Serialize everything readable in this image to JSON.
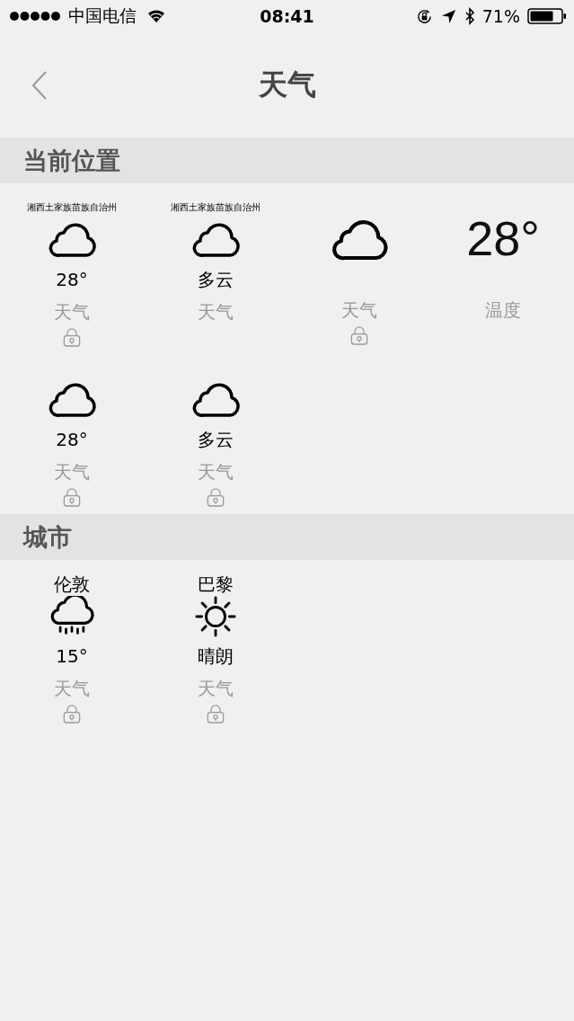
{
  "status_bar": {
    "carrier": "中国电信",
    "time": "08:41",
    "battery": "71%"
  },
  "nav": {
    "title": "天气"
  },
  "sections": [
    {
      "title": "当前位置",
      "widgets": [
        {
          "place": "湘西土家族苗族自治州",
          "kind": "cloud",
          "value": "28°",
          "caption": "天气",
          "locked": true
        },
        {
          "place": "湘西土家族苗族自治州",
          "kind": "cloud",
          "value": "多云",
          "caption": "天气",
          "locked": false
        },
        {
          "kind": "cloud_large",
          "caption": "天气",
          "locked": true
        },
        {
          "kind": "temperature",
          "value": "28°",
          "caption": "温度",
          "locked": false
        },
        {
          "kind": "cloud",
          "value": "28°",
          "caption": "天气",
          "locked": true
        },
        {
          "kind": "cloud",
          "value": "多云",
          "caption": "天气",
          "locked": true
        }
      ]
    },
    {
      "title": "城市",
      "widgets": [
        {
          "city": "伦敦",
          "kind": "rain",
          "value": "15°",
          "caption": "天气",
          "locked": true
        },
        {
          "city": "巴黎",
          "kind": "sun",
          "value": "晴朗",
          "caption": "天气",
          "locked": true
        }
      ]
    }
  ]
}
